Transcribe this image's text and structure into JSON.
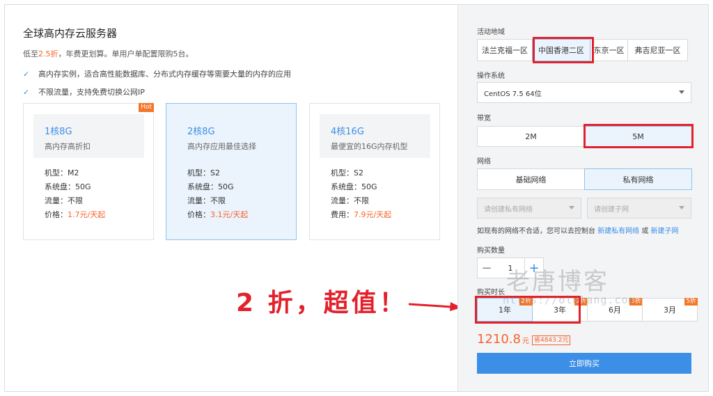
{
  "left": {
    "title": "全球高内存云服务器",
    "promo_prefix": "低至",
    "promo_discount": "2.5折",
    "promo_suffix": "，年费更划算。单用户单配置限购5台。",
    "features": [
      "高内存实例，适合高性能数据库、分布式内存缓存等需要大量的内存的应用",
      "不限流量，支持免费切换公网IP"
    ],
    "cards": [
      {
        "spec": "1核8G",
        "desc": "高内存高折扣",
        "badge": "Hot",
        "rows": [
          {
            "label": "机型：",
            "value": "M2"
          },
          {
            "label": "系统盘：",
            "value": "50G"
          },
          {
            "label": "流量：",
            "value": "不限"
          },
          {
            "label": "价格：",
            "value": "1.7元/天起"
          }
        ]
      },
      {
        "spec": "2核8G",
        "desc": "高内存应用最佳选择",
        "rows": [
          {
            "label": "机型：",
            "value": "S2"
          },
          {
            "label": "系统盘：",
            "value": "50G"
          },
          {
            "label": "流量：",
            "value": "不限"
          },
          {
            "label": "价格：",
            "value": "3.1元/天起"
          }
        ]
      },
      {
        "spec": "4核16G",
        "desc": "最便宜的16G内存机型",
        "rows": [
          {
            "label": "机型：",
            "value": "S2"
          },
          {
            "label": "系统盘：",
            "value": "50G"
          },
          {
            "label": "流量：",
            "value": "不限"
          },
          {
            "label": "费用：",
            "value": "7.9元/天起"
          }
        ]
      }
    ]
  },
  "annotation": {
    "text": "2 折，超值！"
  },
  "right": {
    "region_label": "活动地域",
    "regions": [
      "法兰克福一区",
      "中国香港二区",
      "东京一区",
      "弗吉尼亚一区"
    ],
    "os_label": "操作系统",
    "os_value": "CentOS 7.5 64位",
    "bandwidth_label": "带宽",
    "bandwidth": [
      "2M",
      "5M"
    ],
    "network_label": "网络",
    "network": [
      "基础网络",
      "私有网络"
    ],
    "vpc_placeholder": "请创建私有网络",
    "subnet_placeholder": "请创建子网",
    "hint_text": "如现有的网络不合适，您可以去控制台 ",
    "hint_link1": "新建私有网络",
    "hint_or": " 或 ",
    "hint_link2": "新建子网",
    "qty_label": "购买数量",
    "qty_minus": "−",
    "qty_value": "1",
    "qty_plus": "+",
    "duration_label": "购买时长",
    "durations": [
      {
        "label": "1年",
        "badge": "2折"
      },
      {
        "label": "3年",
        "badge": "2折"
      },
      {
        "label": "6月",
        "badge": "3折"
      },
      {
        "label": "3月",
        "badge": "5折"
      }
    ],
    "price": "1210.8",
    "price_unit": "元",
    "save_text": "省4843.2元",
    "buy_label": "立即购买"
  },
  "watermark": {
    "name": "老唐博客",
    "url": "https://oldtang.com"
  },
  "colors": {
    "accent": "#3b8fe6",
    "price": "#f5632c",
    "badge": "#f47629",
    "annotation": "#e3212b",
    "selected_bg": "#ebf4fc"
  }
}
